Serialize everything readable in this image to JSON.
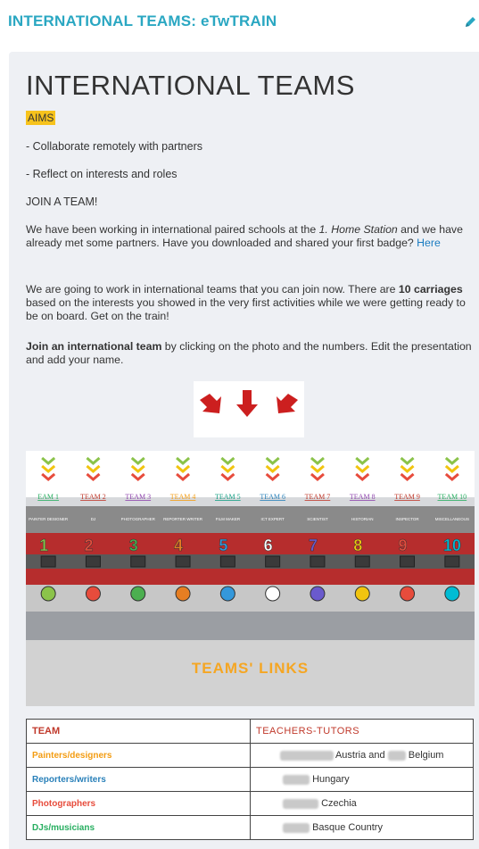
{
  "header": {
    "title": "INTERNATIONAL TEAMS: eTwTRAIN",
    "edit_icon": "pencil-icon",
    "accent_color": "#2aa7c2"
  },
  "content": {
    "title": "INTERNATIONAL TEAMS",
    "aims_label": "AIMS",
    "bullet1": "- Collaborate remotely with partners",
    "bullet2": "- Reflect on interests and roles",
    "join_heading": "JOIN A TEAM!",
    "para1_a": "We have been working in international paired schools at the ",
    "para1_em": "1. Home Station",
    "para1_b": " and we have already met some partners. Have you downloaded and shared your first badge? ",
    "para1_link": "Here",
    "para2_a": "We are going to work in international teams that you can join now. There are ",
    "para2_b": "10 carriages",
    "para2_c": " based on the interests you showed in the very first activities while we were getting ready to be on board. Get on the train!",
    "para3_b": "Join an international team",
    "para3_c": " by clicking on the photo and the numbers. Edit the presentation and add your name."
  },
  "train": {
    "team_labels": [
      "EAM 1",
      "TEAM 2",
      "TEAM 3",
      "TEAM 4",
      "TEAM 5",
      "TEAM 6",
      "TEAM 7",
      "TEAM 8",
      "TEAM 9",
      "TEAM 10"
    ],
    "team_label_colors": [
      "#27ae60",
      "#c0392b",
      "#8e44ad",
      "#f39c12",
      "#16a085",
      "#2980b9",
      "#c0392b",
      "#8e44ad",
      "#c0392b",
      "#27ae60"
    ],
    "numbers": [
      "1",
      "2",
      "3",
      "4",
      "5",
      "6",
      "7",
      "8",
      "9",
      "10"
    ],
    "number_colors": [
      "#8bc34a",
      "#e74c3c",
      "#4caf50",
      "#e67e22",
      "#3498db",
      "#ffffff",
      "#6a5acd",
      "#f1c40f",
      "#e74c3c",
      "#00bcd4"
    ],
    "roles": [
      "PAINTER DESIGNER",
      "DJ",
      "PHOTOGRAPHER",
      "REPORTER WRITER",
      "FILM MAKER",
      "ICT EXPERT",
      "SCIENTIST",
      "HISTORIAN",
      "INSPECTOR",
      "MISCELLANEOUS"
    ],
    "teams_links_label": "TEAMS' LINKS"
  },
  "table": {
    "header": {
      "team": "TEAM",
      "tutors": "TEACHERS-TUTORS"
    },
    "rows": [
      {
        "team": "Painters/designers",
        "color": "#f39c12",
        "tutor_a": "Austria and",
        "tutor_b": "Belgium"
      },
      {
        "team": "Reporters/writers",
        "color": "#2980b9",
        "tutor_a": "Hungary",
        "tutor_b": ""
      },
      {
        "team": "Photographers",
        "color": "#e74c3c",
        "tutor_a": "Czechia",
        "tutor_b": ""
      },
      {
        "team": "DJs/musicians",
        "color": "#27ae60",
        "tutor_a": "Basque Country",
        "tutor_b": ""
      }
    ]
  }
}
